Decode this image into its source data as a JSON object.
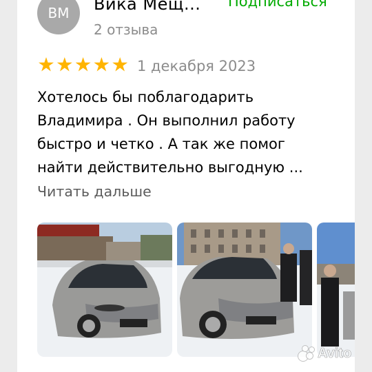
{
  "author": {
    "initials": "ВМ",
    "name": "Вика Мещ...",
    "review_count": "2 отзыва",
    "subscribe_label": "Подписаться"
  },
  "review": {
    "rating": 5,
    "rating_max": 5,
    "date": "1 декабря 2023",
    "text": "Хотелось бы поблагодарить\nВладимира . Он выполнил работу\nбыстро и четко . А так же помог\nнайти действительно выгодную ...",
    "read_more_label": "Читать дальше"
  },
  "photos": [
    {
      "name": "review-photo-1",
      "scene": "car-front-snow-left"
    },
    {
      "name": "review-photo-2",
      "scene": "car-front-snow-people"
    },
    {
      "name": "review-photo-3",
      "scene": "people-partial"
    }
  ],
  "watermark": {
    "text": "Avito"
  },
  "colors": {
    "accent_green": "#00aa00",
    "star": "#ffb400",
    "secondary_text": "#8c8c8c",
    "avatar_bg": "#a9a9a9",
    "page_bg": "#ececec"
  }
}
